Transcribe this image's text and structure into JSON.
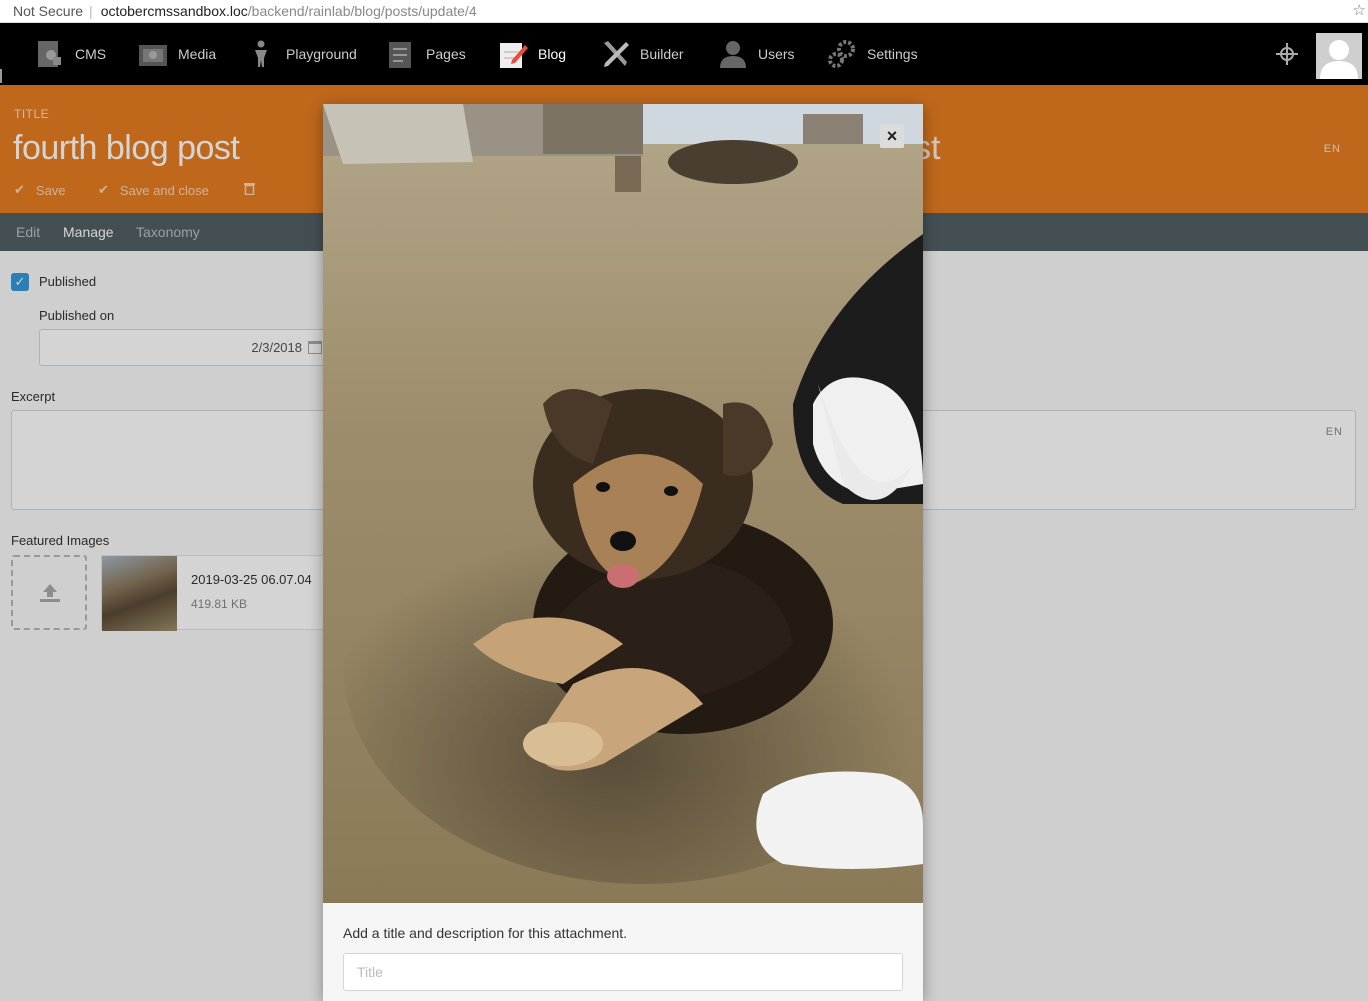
{
  "browser": {
    "security": "Not Secure",
    "host": "octobercmssandbox.loc",
    "path": "/backend/rainlab/blog/posts/update/4"
  },
  "nav": {
    "items": [
      {
        "label": "CMS",
        "icon": "cms-icon"
      },
      {
        "label": "Media",
        "icon": "media-icon"
      },
      {
        "label": "Playground",
        "icon": "playground-icon"
      },
      {
        "label": "Pages",
        "icon": "pages-icon"
      },
      {
        "label": "Blog",
        "icon": "blog-icon",
        "active": true
      },
      {
        "label": "Builder",
        "icon": "builder-icon"
      },
      {
        "label": "Users",
        "icon": "users-icon"
      },
      {
        "label": "Settings",
        "icon": "settings-icon"
      }
    ]
  },
  "header": {
    "field_label": "TITLE",
    "title": "fourth blog post",
    "title_ghost": "st",
    "lang": "EN",
    "save_label": "Save",
    "save_close_label": "Save and close"
  },
  "tabs": [
    {
      "label": "Edit"
    },
    {
      "label": "Manage",
      "active": true
    },
    {
      "label": "Taxonomy"
    }
  ],
  "form": {
    "published_label": "Published",
    "published_checked": true,
    "published_on_label": "Published on",
    "published_on_value": "2/3/2018",
    "excerpt_label": "Excerpt",
    "excerpt_lang": "EN",
    "featured_label": "Featured Images",
    "file_name": "2019-03-25 06.07.04",
    "file_size": "419.81 KB"
  },
  "modal": {
    "hint": "Add a title and description for this attachment.",
    "title_placeholder": "Title",
    "close_symbol": "×"
  },
  "colors": {
    "accent": "#e67e22",
    "tabs_bg": "#526066",
    "checkbox": "#3498db"
  }
}
